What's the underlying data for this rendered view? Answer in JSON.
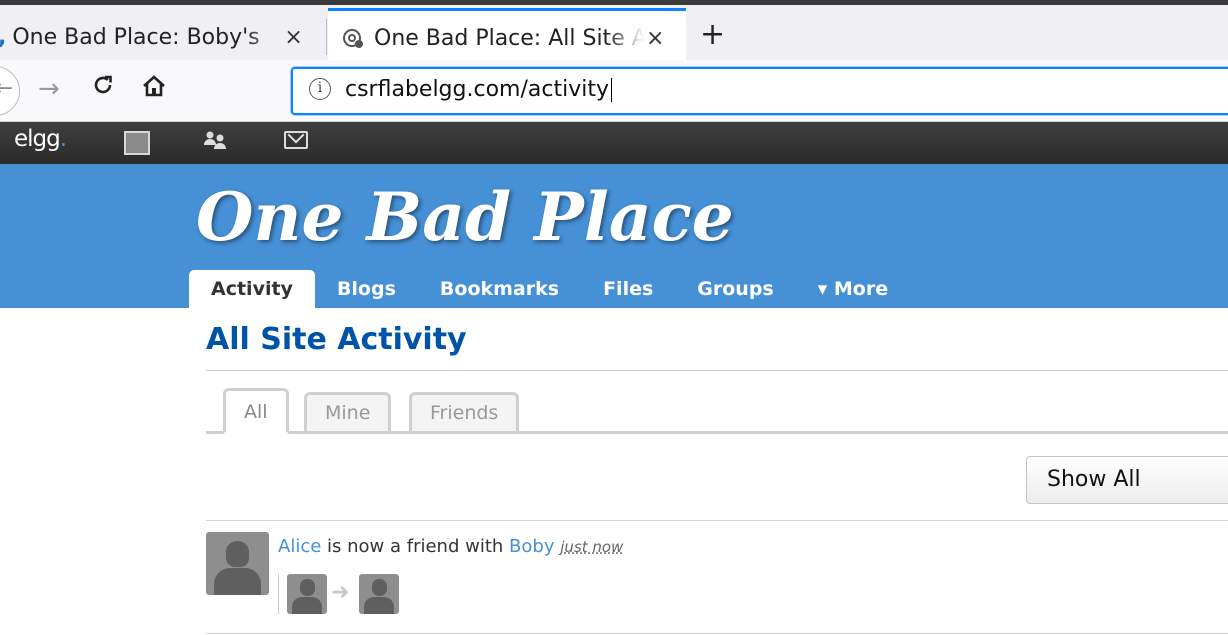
{
  "browser": {
    "tabs": [
      {
        "title": "One Bad Place: Boby's",
        "close": "×"
      },
      {
        "title": "One Bad Place: All Site Activity",
        "close": "×"
      }
    ],
    "new_tab_label": "+",
    "url": "csrflabelgg.com/activity",
    "url_info_label": "i"
  },
  "topbar": {
    "logo": "elgg",
    "logo_dot": "."
  },
  "site": {
    "title": "One Bad Place",
    "menu": [
      "Activity",
      "Blogs",
      "Bookmarks",
      "Files",
      "Groups",
      "▾ More"
    ]
  },
  "page": {
    "title": "All Site Activity",
    "filter_tabs": [
      "All",
      "Mine",
      "Friends"
    ],
    "show_filter": "Show All"
  },
  "river": {
    "items": [
      {
        "subject": "Alice",
        "action": "is now a friend with",
        "object": "Boby",
        "time": "just now"
      }
    ]
  }
}
